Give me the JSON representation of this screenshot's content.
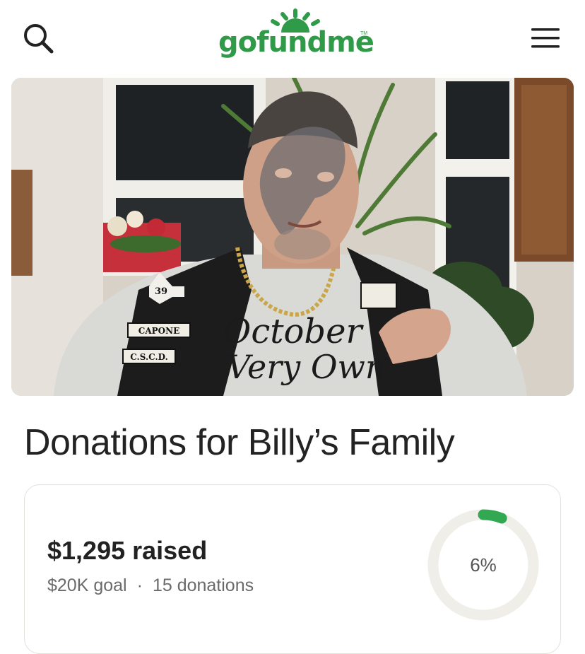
{
  "header": {
    "logo_text": "gofundme",
    "logo_tm": "TM",
    "icons": {
      "search": "search-icon",
      "menu": "hamburger-menu-icon"
    },
    "brand_color": "#2f9a48"
  },
  "hero": {
    "patches": [
      "39",
      "CAPONE",
      "C.S.C.D."
    ],
    "shirt_text": [
      "October",
      "Very Own"
    ]
  },
  "campaign": {
    "title": "Donations for Billy’s Family",
    "raised": "$1,295 raised",
    "goal": "$20K goal",
    "separator": "·",
    "donations": "15 donations",
    "progress_percent_label": "6%",
    "progress_fraction": 0.06,
    "progress_color": "#33a852",
    "track_color": "#efeee9"
  }
}
